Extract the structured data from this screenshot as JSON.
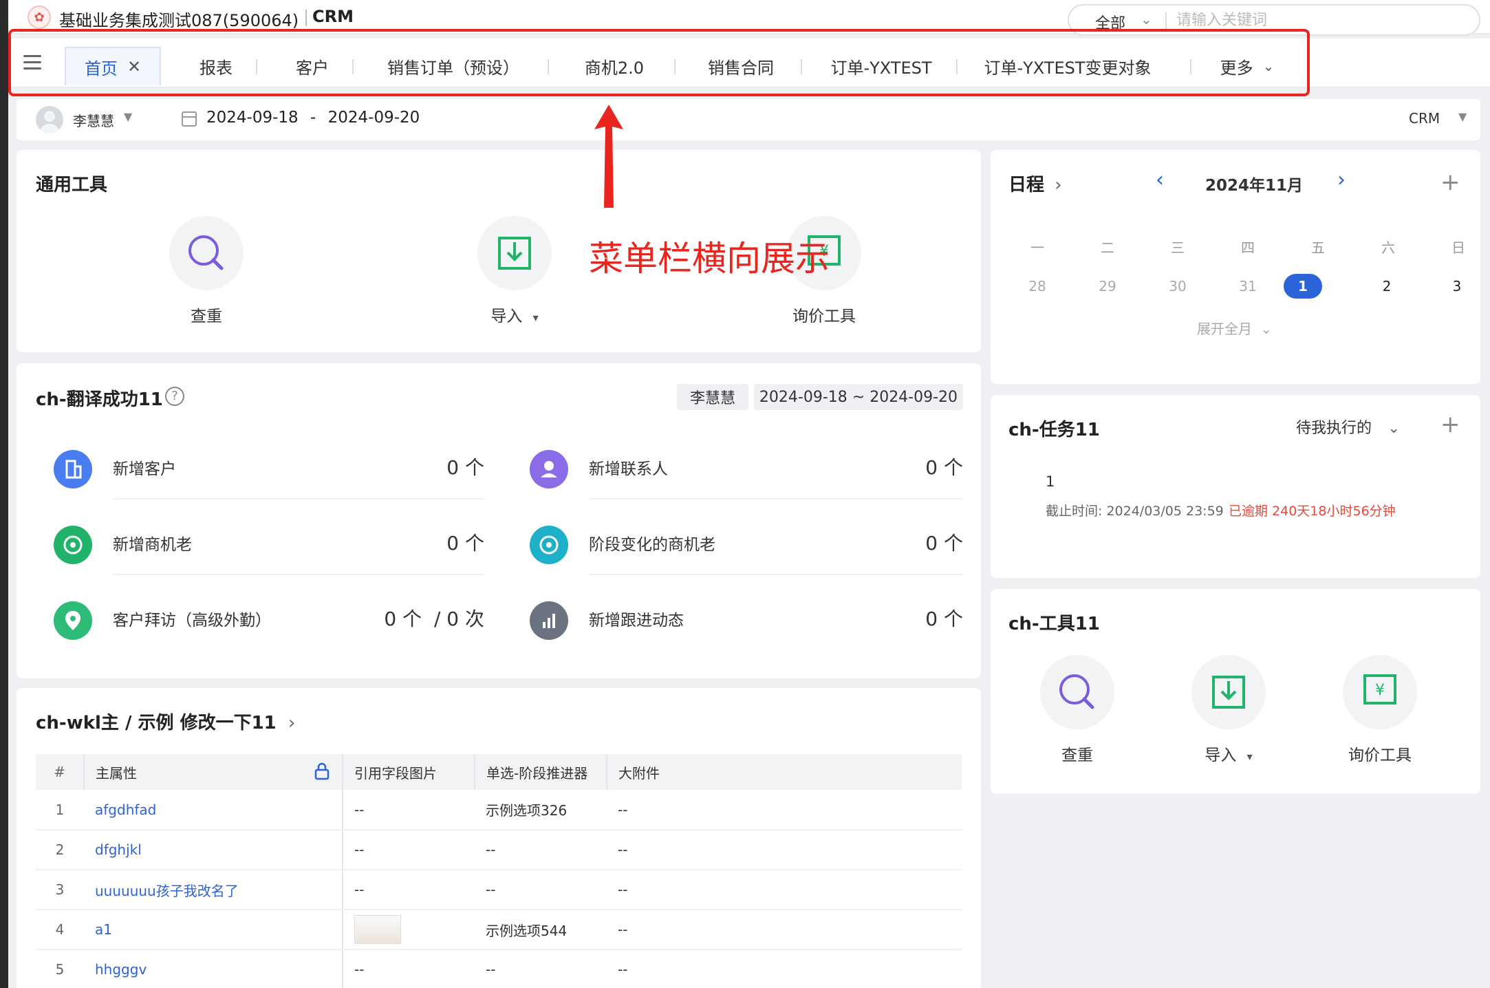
{
  "header": {
    "tenant": "基础业务集成测试087(590064)",
    "app": "CRM",
    "search_scope": "全部",
    "search_placeholder": "请输入关键词"
  },
  "tabs": [
    {
      "label": "首页",
      "active": true
    },
    {
      "label": "报表"
    },
    {
      "label": "客户"
    },
    {
      "label": "销售订单（预设）"
    },
    {
      "label": "商机2.0"
    },
    {
      "label": "销售合同"
    },
    {
      "label": "订单-YXTEST"
    },
    {
      "label": "订单-YXTEST变更对象"
    },
    {
      "label": "更多"
    }
  ],
  "filter": {
    "user": "李慧慧",
    "date_start": "2024-09-18",
    "date_sep": "-",
    "date_end": "2024-09-20",
    "scope": "CRM"
  },
  "tools_card": {
    "title": "通用工具",
    "tools": [
      {
        "label": "查重",
        "icon": "search-icon"
      },
      {
        "label": "导入",
        "icon": "import-icon",
        "caret": "▾"
      },
      {
        "label": "询价工具",
        "icon": "price-icon"
      }
    ]
  },
  "stats_card": {
    "title": "ch-翻译成功11",
    "help_icon": "?",
    "user_chip": "李慧慧",
    "date_chip": "2024-09-18 ~ 2024-09-20",
    "items": [
      {
        "label": "新增客户",
        "value": "0 个",
        "color": "#4a7df0"
      },
      {
        "label": "新增联系人",
        "value": "0 个",
        "color": "#8a6ce8"
      },
      {
        "label": "新增商机老",
        "value": "0 个",
        "color": "#22b36b"
      },
      {
        "label": "阶段变化的商机老",
        "value": "0 个",
        "color": "#1fb0c9"
      },
      {
        "label": "客户拜访（高级外勤）",
        "value": "0 个  / 0 次",
        "color": "#2dbb78"
      },
      {
        "label": "新增跟进动态",
        "value": "0 个",
        "color": "#6b7280"
      }
    ]
  },
  "list_card": {
    "title": "ch-wkl主 / 示例 修改一下11",
    "columns": [
      "#",
      "主属性",
      "引用字段图片",
      "单选-阶段推进器",
      "大附件"
    ],
    "rows": [
      {
        "num": "1",
        "name": "afgdhfad",
        "img": "--",
        "stage": "示例选项326",
        "file": "--"
      },
      {
        "num": "2",
        "name": "dfghjkl",
        "img": "--",
        "stage": "--",
        "file": "--"
      },
      {
        "num": "3",
        "name": "uuuuuuu孩子我改名了",
        "img": "--",
        "stage": "--",
        "file": "--"
      },
      {
        "num": "4",
        "name": "a1",
        "img": "",
        "stage": "示例选项544",
        "file": "--"
      },
      {
        "num": "5",
        "name": "hhgggv",
        "img": "--",
        "stage": "--",
        "file": "--"
      }
    ]
  },
  "calendar": {
    "title": "日程",
    "month": "2024年11月",
    "weekdays": [
      "一",
      "二",
      "三",
      "四",
      "五",
      "六",
      "日"
    ],
    "days": [
      {
        "d": "28",
        "muted": true
      },
      {
        "d": "29",
        "muted": true
      },
      {
        "d": "30",
        "muted": true
      },
      {
        "d": "31",
        "muted": true
      },
      {
        "d": "1",
        "today": true
      },
      {
        "d": "2"
      },
      {
        "d": "3"
      }
    ],
    "expand": "展开全月"
  },
  "tasks": {
    "title": "ch-任务11",
    "filter": "待我执行的",
    "item_name": "1",
    "deadline": "截止时间: 2024/03/05 23:59",
    "overdue": "已逾期 240天18小时56分钟"
  },
  "tools2": {
    "title": "ch-工具11",
    "tools": [
      {
        "label": "查重"
      },
      {
        "label": "导入",
        "caret": "▾"
      },
      {
        "label": "询价工具"
      }
    ]
  },
  "annotation": {
    "text": "菜单栏横向展示"
  },
  "colors": {
    "accent": "#2b63d9",
    "annotation": "#e8261f",
    "overdue": "#e8483a"
  }
}
